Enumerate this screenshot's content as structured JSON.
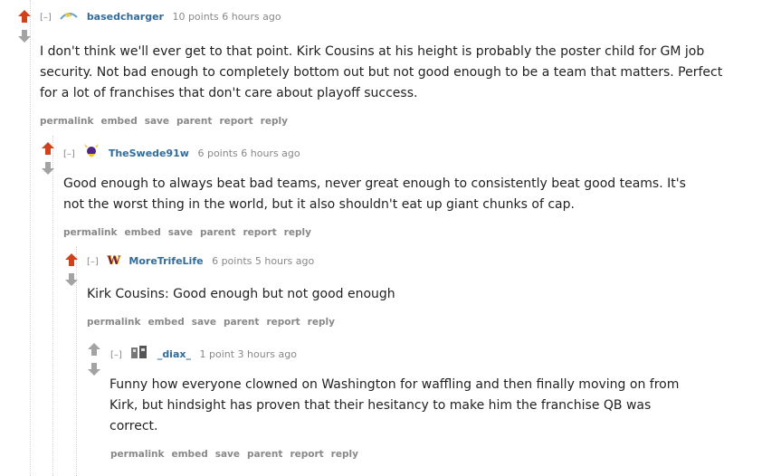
{
  "comments": [
    {
      "collapse": "[–]",
      "author": "basedcharger",
      "score": "10 points",
      "time": "6 hours ago",
      "body": "I don't think we'll ever get to that point. Kirk Cousins at his height is probably the poster child for GM job security. Not bad enough to completely bottom out but not good enough to be a team that matters. Perfect for a lot of franchises that don't care about playoff success.",
      "flair": "chargers-bolt-flair",
      "upvoted": true
    },
    {
      "collapse": "[–]",
      "author": "TheSwede91w",
      "score": "6 points",
      "time": "6 hours ago",
      "body": "Good enough to always beat bad teams, never great enough to consistently beat good teams. It's not the worst thing in the world, but it also shouldn't eat up giant chunks of cap.",
      "flair": "vikings-flair",
      "upvoted": true
    },
    {
      "collapse": "[–]",
      "author": "MoreTrifeLife",
      "score": "6 points",
      "time": "5 hours ago",
      "body": "Kirk Cousins: Good enough but not good enough",
      "flair": "washington-w-flair",
      "flair_text": "W",
      "upvoted": true
    },
    {
      "collapse": "[–]",
      "author": "_diax_",
      "score": "1 point",
      "time": "3 hours ago",
      "body": "Funny how everyone clowned on Washington for waffling and then finally moving on from Kirk, but hindsight has proven that their hesitancy to make him the franchise QB was correct.",
      "flair": "team-flair",
      "upvoted": false
    }
  ],
  "buttons": {
    "permalink": "permalink",
    "embed": "embed",
    "save": "save",
    "parent": "parent",
    "report": "report",
    "reply": "reply"
  },
  "colors": {
    "upvote_active": "#d0421c",
    "vote_inactive": "#a3a3a3",
    "author": "#336b99",
    "meta": "#888888"
  }
}
